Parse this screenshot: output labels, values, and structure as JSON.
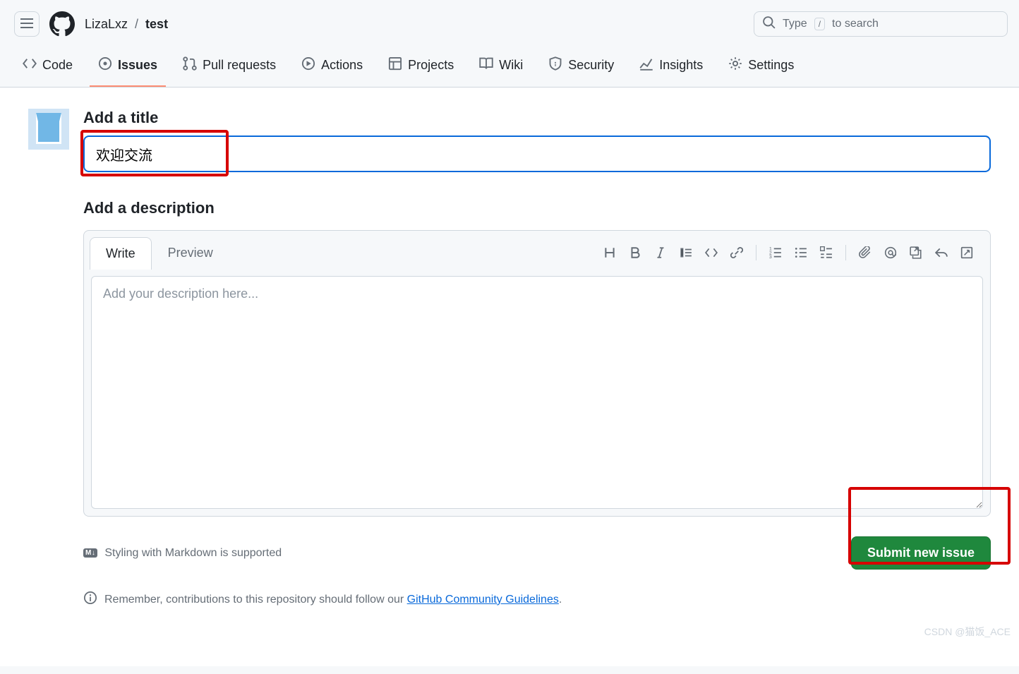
{
  "header": {
    "owner": "LizaLxz",
    "separator": "/",
    "repo": "test",
    "search_prefix": "Type",
    "search_slash": "/",
    "search_suffix": "to search"
  },
  "nav": {
    "code": "Code",
    "issues": "Issues",
    "pulls": "Pull requests",
    "actions": "Actions",
    "projects": "Projects",
    "wiki": "Wiki",
    "security": "Security",
    "insights": "Insights",
    "settings": "Settings"
  },
  "form": {
    "title_label": "Add a title",
    "title_value": "欢迎交流",
    "desc_label": "Add a description",
    "tab_write": "Write",
    "tab_preview": "Preview",
    "desc_placeholder": "Add your description here...",
    "md_support": "Styling with Markdown is supported",
    "md_badge": "M↓",
    "submit_label": "Submit new issue",
    "guidelines_prefix": "Remember, contributions to this repository should follow our ",
    "guidelines_link": "GitHub Community Guidelines",
    "guidelines_suffix": "."
  },
  "watermark": "CSDN @猫饭_ACE"
}
